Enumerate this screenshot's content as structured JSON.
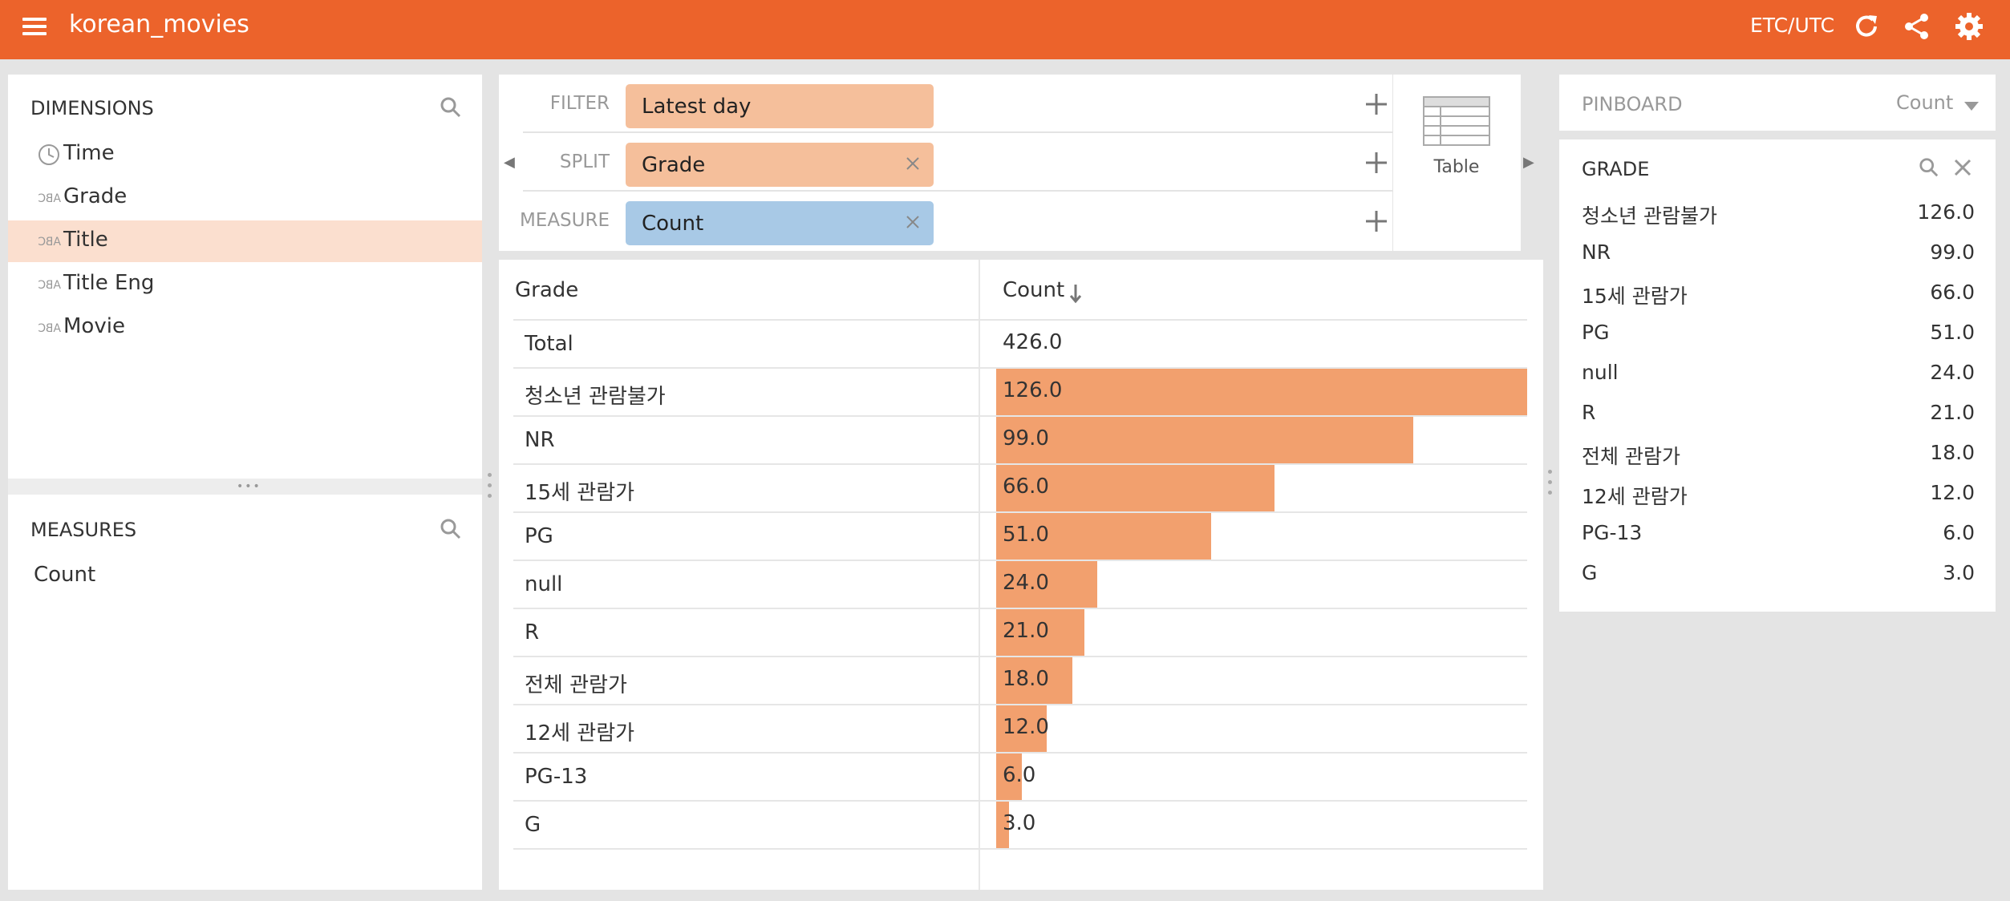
{
  "app": {
    "title": "korean_movies",
    "timezone": "ETC/UTC"
  },
  "colors": {
    "brand": "#ec632b",
    "bar": "#f2a06e",
    "filter_pill": "#f5bf9b",
    "measure_pill": "#a8c9e6",
    "selected_row": "#fbdfcf"
  },
  "topbar_icons": [
    "menu-icon",
    "refresh-icon",
    "share-icon",
    "gear-icon"
  ],
  "dimensions": {
    "title": "DIMENSIONS",
    "items": [
      {
        "label": "Time",
        "icon": "clock-icon"
      },
      {
        "label": "Grade",
        "icon": "string-type-icon"
      },
      {
        "label": "Title",
        "icon": "string-type-icon",
        "selected": true
      },
      {
        "label": "Title Eng",
        "icon": "string-type-icon"
      },
      {
        "label": "Movie",
        "icon": "string-type-icon"
      }
    ]
  },
  "measures": {
    "title": "MEASURES",
    "items": [
      {
        "label": "Count"
      }
    ]
  },
  "controls": {
    "filter": {
      "label": "FILTER",
      "pill": "Latest day"
    },
    "split": {
      "label": "SPLIT",
      "pill": "Grade"
    },
    "measure": {
      "label": "MEASURE",
      "pill": "Count"
    },
    "visualization": "Table"
  },
  "table": {
    "columns": [
      "Grade",
      "Count"
    ],
    "sort": "descending",
    "total": {
      "label": "Total",
      "value": "426.0"
    },
    "max_value": 126
  },
  "chart_data": {
    "type": "bar",
    "categories": [
      "청소년 관람불가",
      "NR",
      "15세 관람가",
      "PG",
      "null",
      "R",
      "전체 관람가",
      "12세 관람가",
      "PG-13",
      "G"
    ],
    "values": [
      126.0,
      99.0,
      66.0,
      51.0,
      24.0,
      21.0,
      18.0,
      12.0,
      6.0,
      3.0
    ],
    "value_labels": [
      "126.0",
      "99.0",
      "66.0",
      "51.0",
      "24.0",
      "21.0",
      "18.0",
      "12.0",
      "6.0",
      "3.0"
    ],
    "xlabel": "Grade",
    "ylabel": "Count"
  },
  "pinboard": {
    "title": "PINBOARD",
    "sort_measure": "Count",
    "section": "GRADE",
    "items": [
      {
        "label": "청소년 관람불가",
        "value": "126.0"
      },
      {
        "label": "NR",
        "value": "99.0"
      },
      {
        "label": "15세 관람가",
        "value": "66.0"
      },
      {
        "label": "PG",
        "value": "51.0"
      },
      {
        "label": "null",
        "value": "24.0"
      },
      {
        "label": "R",
        "value": "21.0"
      },
      {
        "label": "전체 관람가",
        "value": "18.0"
      },
      {
        "label": "12세 관람가",
        "value": "12.0"
      },
      {
        "label": "PG-13",
        "value": "6.0"
      },
      {
        "label": "G",
        "value": "3.0"
      }
    ]
  }
}
